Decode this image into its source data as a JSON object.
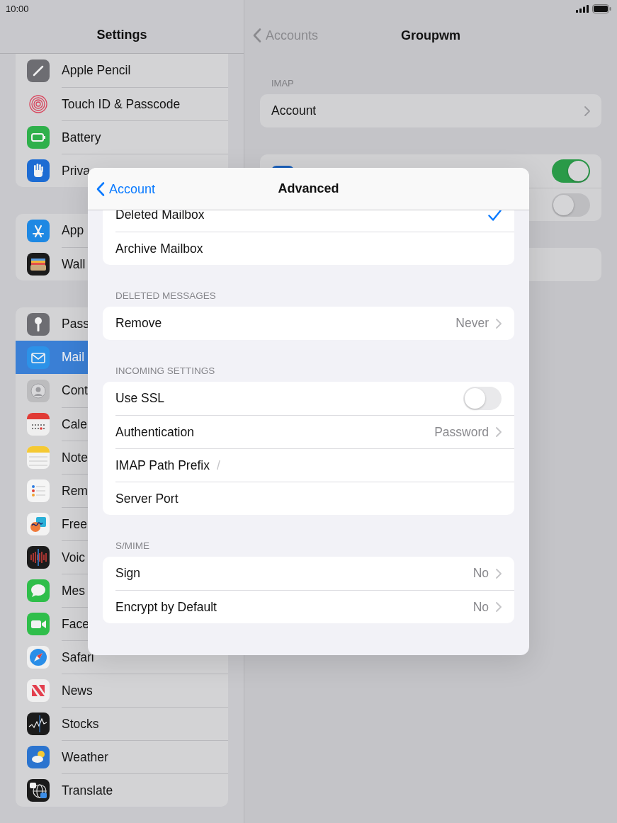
{
  "status_bar": {
    "time": "10:00"
  },
  "sidebar": {
    "title": "Settings",
    "groups": [
      {
        "items": [
          {
            "label": "Apple Pencil",
            "selected": false
          },
          {
            "label": "Touch ID & Passcode",
            "selected": false
          },
          {
            "label": "Battery",
            "selected": false
          },
          {
            "label": "Priva",
            "selected": false
          }
        ]
      },
      {
        "items": [
          {
            "label": "App",
            "selected": false
          },
          {
            "label": "Wall",
            "selected": false
          }
        ]
      },
      {
        "items": [
          {
            "label": "Pass",
            "selected": false
          },
          {
            "label": "Mail",
            "selected": true
          },
          {
            "label": "Cont",
            "selected": false
          },
          {
            "label": "Cale",
            "selected": false
          },
          {
            "label": "Note",
            "selected": false
          },
          {
            "label": "Rem",
            "selected": false
          },
          {
            "label": "Free",
            "selected": false
          },
          {
            "label": "Voic",
            "selected": false
          },
          {
            "label": "Mes",
            "selected": false
          },
          {
            "label": "Face",
            "selected": false
          },
          {
            "label": "Safari",
            "selected": false
          },
          {
            "label": "News",
            "selected": false
          },
          {
            "label": "Stocks",
            "selected": false
          },
          {
            "label": "Weather",
            "selected": false
          },
          {
            "label": "Translate",
            "selected": false
          }
        ]
      }
    ]
  },
  "detail": {
    "back": "Accounts",
    "title": "Groupwm",
    "sections": [
      {
        "header": "IMAP",
        "rows": [
          {
            "kind": "link",
            "label": "Account"
          }
        ]
      },
      {
        "rows": [
          {
            "kind": "icon-toggle",
            "on": true
          },
          {
            "kind": "toggle",
            "on": false
          }
        ]
      },
      {
        "rows": [
          {
            "kind": "blank"
          }
        ]
      }
    ]
  },
  "modal": {
    "back": "Account",
    "title": "Advanced",
    "groups": [
      {
        "rows": [
          {
            "kind": "check",
            "label": "Deleted Mailbox",
            "checked": true
          },
          {
            "kind": "check",
            "label": "Archive Mailbox",
            "checked": false
          }
        ]
      },
      {
        "header": "DELETED MESSAGES",
        "rows": [
          {
            "kind": "value",
            "label": "Remove",
            "value": "Never"
          }
        ]
      },
      {
        "header": "INCOMING SETTINGS",
        "rows": [
          {
            "kind": "toggle",
            "label": "Use SSL",
            "on": false
          },
          {
            "kind": "value",
            "label": "Authentication",
            "value": "Password"
          },
          {
            "kind": "field",
            "label": "IMAP Path Prefix",
            "value": "/"
          },
          {
            "kind": "field",
            "label": "Server Port"
          }
        ]
      },
      {
        "header": "S/MIME",
        "rows": [
          {
            "kind": "value",
            "label": "Sign",
            "value": "No"
          },
          {
            "kind": "value",
            "label": "Encrypt by Default",
            "value": "No"
          }
        ]
      }
    ]
  }
}
